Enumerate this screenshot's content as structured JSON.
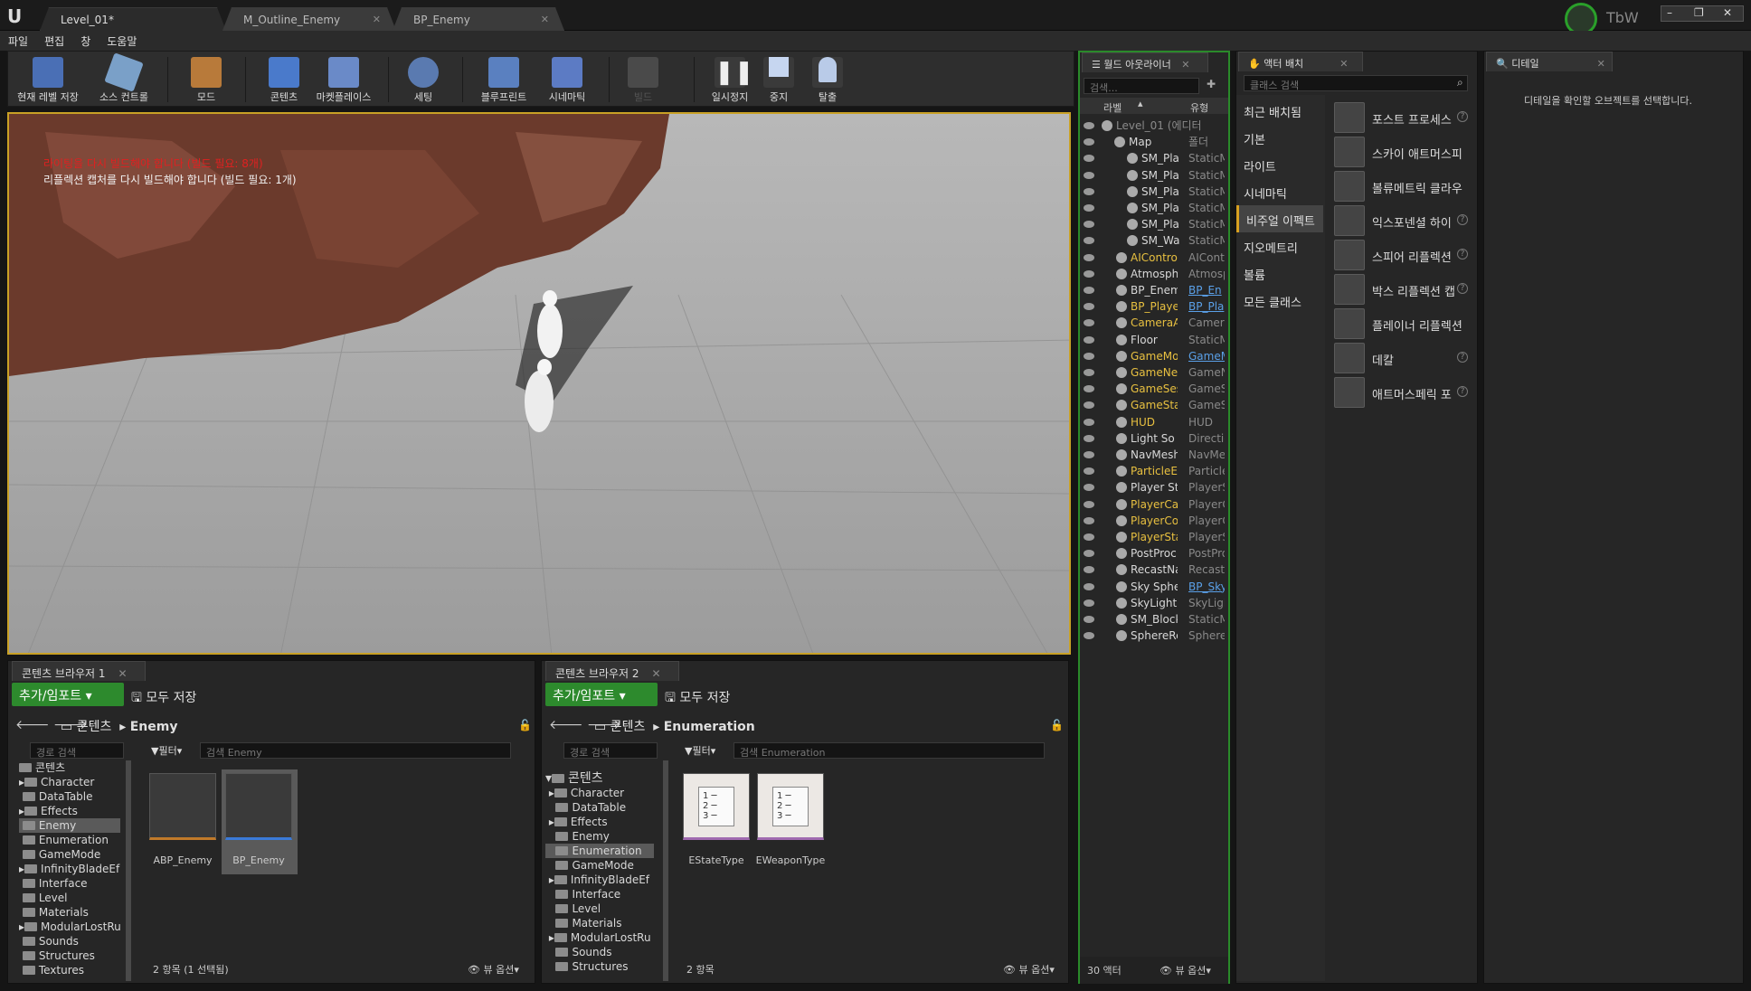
{
  "title_bar": {
    "tabs": [
      "Level_01*",
      "M_Outline_Enemy",
      "BP_Enemy"
    ],
    "user": "TbW"
  },
  "menu": [
    "파일",
    "편집",
    "창",
    "도움말"
  ],
  "toolbar": [
    {
      "label": "현재 레벨 저장",
      "icon": "save-icon"
    },
    {
      "label": "소스 컨트롤",
      "icon": "source-control-icon"
    },
    {
      "label": "모드",
      "icon": "modes-icon"
    },
    {
      "label": "콘텐츠",
      "icon": "content-icon"
    },
    {
      "label": "마켓플레이스",
      "icon": "marketplace-icon"
    },
    {
      "label": "세팅",
      "icon": "settings-icon"
    },
    {
      "label": "블루프린트",
      "icon": "blueprint-icon"
    },
    {
      "label": "시네마틱",
      "icon": "cinematics-icon"
    },
    {
      "label": "빌드",
      "icon": "build-icon"
    },
    {
      "label": "일시정지",
      "icon": "pause-icon"
    },
    {
      "label": "중지",
      "icon": "stop-icon"
    },
    {
      "label": "탈출",
      "icon": "eject-icon"
    }
  ],
  "viewport": {
    "warning_line1": "라이팅을 다시 빌드해야 합니다 (빌드 필요: 8개)",
    "warning_line2": "리플렉션 캡처를 다시 빌드해야 합니다 (빌드 필요: 1개)"
  },
  "content_browser_1": {
    "tab": "콘텐츠 브라우저 1",
    "add_import": "추가/임포트",
    "save_all": "모두 저장",
    "path_root": "콘텐츠",
    "path_current": "Enemy",
    "path_search": "경로 검색",
    "filter": "필터",
    "search_placeholder": "검색 Enemy",
    "folders": [
      "콘텐츠",
      "Character",
      "DataTable",
      "Effects",
      "Enemy",
      "Enumeration",
      "GameMode",
      "InfinityBladeEf",
      "Interface",
      "Level",
      "Materials",
      "ModularLostRu",
      "Sounds",
      "Structures",
      "Textures"
    ],
    "assets": [
      "ABP_Enemy",
      "BP_Enemy"
    ],
    "status": "2 항목 (1 선택됨)",
    "view_options": "뷰 옵션"
  },
  "content_browser_2": {
    "tab": "콘텐츠 브라우저 2",
    "add_import": "추가/임포트",
    "save_all": "모두 저장",
    "path_root": "콘텐츠",
    "path_current": "Enumeration",
    "path_search": "경로 검색",
    "filter": "필터",
    "search_placeholder": "검색 Enumeration",
    "folders": [
      "콘텐츠",
      "Character",
      "DataTable",
      "Effects",
      "Enemy",
      "Enumeration",
      "GameMode",
      "InfinityBladeEf",
      "Interface",
      "Level",
      "Materials",
      "ModularLostRu",
      "Sounds",
      "Structures"
    ],
    "assets": [
      "EStateType",
      "EWeaponType"
    ],
    "status": "2 항목",
    "view_options": "뷰 옵션"
  },
  "outliner": {
    "tab": "월드 아웃라이너",
    "search_placeholder": "검색...",
    "col_label": "라벨",
    "col_type": "유형",
    "rows": [
      {
        "name": "Level_01 (에디터",
        "type": "",
        "color": "#8a8a8a"
      },
      {
        "name": "Map",
        "type": "폴더",
        "color": "#d8d8d8"
      },
      {
        "name": "SM_Pla",
        "type": "StaticM",
        "color": "#d8d8d8"
      },
      {
        "name": "SM_Pla",
        "type": "StaticM",
        "color": "#d8d8d8"
      },
      {
        "name": "SM_Pla",
        "type": "StaticM",
        "color": "#d8d8d8"
      },
      {
        "name": "SM_Pla",
        "type": "StaticM",
        "color": "#d8d8d8"
      },
      {
        "name": "SM_Pla",
        "type": "StaticM",
        "color": "#d8d8d8"
      },
      {
        "name": "SM_Wa",
        "type": "StaticM",
        "color": "#d8d8d8"
      },
      {
        "name": "AIControl",
        "type": "AIContr",
        "color": "#e8c040"
      },
      {
        "name": "Atmosph",
        "type": "Atmosp",
        "color": "#d8d8d8"
      },
      {
        "name": "BP_Enem",
        "type": "BP_En",
        "color": "#d8d8d8"
      },
      {
        "name": "BP_Playe",
        "type": "BP_Pla",
        "color": "#e8c040"
      },
      {
        "name": "CameraA",
        "type": "Camera",
        "color": "#e8c040"
      },
      {
        "name": "Floor",
        "type": "StaticM",
        "color": "#d8d8d8"
      },
      {
        "name": "GameMo",
        "type": "GameM",
        "color": "#e8c040"
      },
      {
        "name": "GameNet",
        "type": "GameN",
        "color": "#e8c040"
      },
      {
        "name": "GameSes",
        "type": "GameS",
        "color": "#e8c040"
      },
      {
        "name": "GameSta",
        "type": "GameSt",
        "color": "#e8c040"
      },
      {
        "name": "HUD",
        "type": "HUD",
        "color": "#e8c040"
      },
      {
        "name": "Light So",
        "type": "Directio",
        "color": "#d8d8d8"
      },
      {
        "name": "NavMesh",
        "type": "NavMes",
        "color": "#d8d8d8"
      },
      {
        "name": "ParticleE",
        "type": "Particle",
        "color": "#e8c040"
      },
      {
        "name": "Player St",
        "type": "PlayerS",
        "color": "#d8d8d8"
      },
      {
        "name": "PlayerCa",
        "type": "PlayerC",
        "color": "#e8c040"
      },
      {
        "name": "PlayerCo",
        "type": "PlayerC",
        "color": "#e8c040"
      },
      {
        "name": "PlayerSta",
        "type": "PlayerS",
        "color": "#e8c040"
      },
      {
        "name": "PostProc",
        "type": "PostPro",
        "color": "#d8d8d8"
      },
      {
        "name": "RecastNa",
        "type": "Recast",
        "color": "#d8d8d8"
      },
      {
        "name": "Sky Sphe",
        "type": "BP_Sky",
        "color": "#d8d8d8"
      },
      {
        "name": "SkyLight",
        "type": "SkyLigh",
        "color": "#d8d8d8"
      },
      {
        "name": "SM_Block",
        "type": "StaticM",
        "color": "#d8d8d8"
      },
      {
        "name": "SphereRe",
        "type": "SphereF",
        "color": "#d8d8d8"
      }
    ],
    "actor_count": "30 액터",
    "view_options": "뷰 옵션"
  },
  "place_actors": {
    "tab": "액터 배치",
    "search_placeholder": "클래스 검색",
    "categories": [
      "최근 배치됨",
      "기본",
      "라이트",
      "시네마틱",
      "비주얼 이펙트",
      "지오메트리",
      "볼륨",
      "모든 클래스"
    ],
    "selected_category": "비주얼 이펙트",
    "items": [
      "포스트 프로세스",
      "스카이 애트머스피어",
      "볼류메트릭 클라우드",
      "익스포넨셜 하이",
      "스피어 리플렉션",
      "박스 리플렉션 캡",
      "플레이너 리플렉션",
      "데칼",
      "애트머스페릭 포"
    ]
  },
  "details": {
    "tab": "디테일",
    "empty_message": "디테일을 확인할 오브젝트를 선택합니다."
  },
  "colors": {
    "accent": "#2d8a2d",
    "viewport_border": "#c9a125",
    "warning": "#e02020"
  }
}
